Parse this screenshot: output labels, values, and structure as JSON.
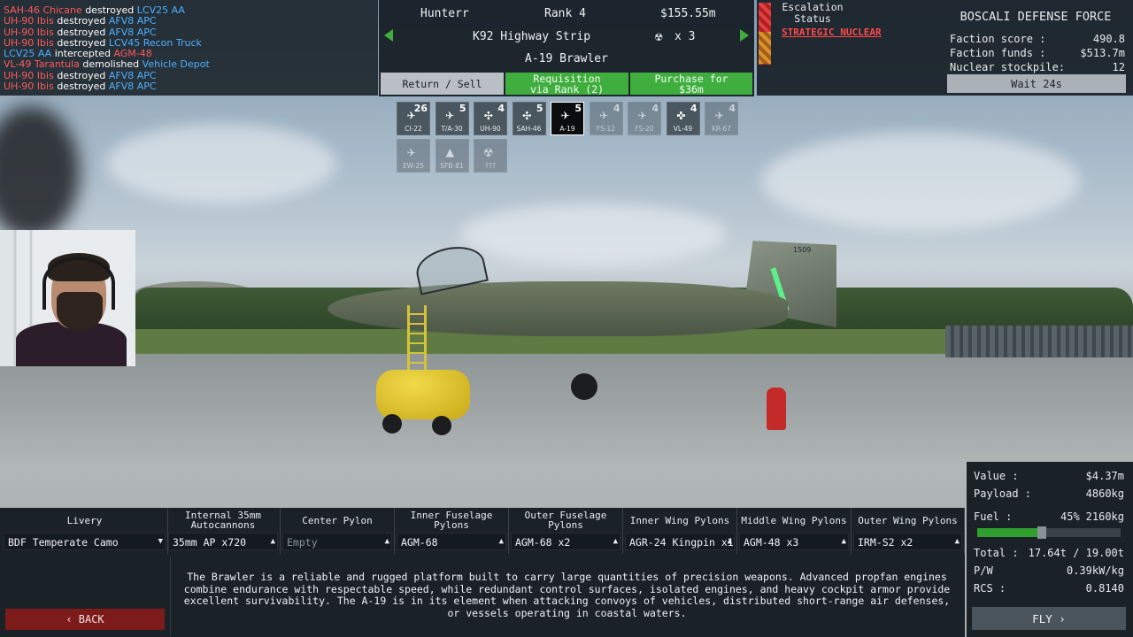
{
  "killfeed": [
    {
      "a": "SAH-46 Chicane",
      "ac": "kf-r",
      "verb": "destroyed",
      "t": "LCV25 AA",
      "tc": "kf-b"
    },
    {
      "a": "UH-90 Ibis",
      "ac": "kf-r",
      "verb": "destroyed",
      "t": "AFV8 APC",
      "tc": "kf-b"
    },
    {
      "a": "UH-90 Ibis",
      "ac": "kf-r",
      "verb": "destroyed",
      "t": "AFV8 APC",
      "tc": "kf-b"
    },
    {
      "a": "UH-90 Ibis",
      "ac": "kf-r",
      "verb": "destroyed",
      "t": "LCV45 Recon Truck",
      "tc": "kf-b"
    },
    {
      "a": "LCV25 AA",
      "ac": "kf-b",
      "verb": "intercepted",
      "t": "AGM-48",
      "tc": "kf-r"
    },
    {
      "a": "VL-49 Tarantula",
      "ac": "kf-r",
      "verb": "demolished",
      "t": "Vehicle Depot",
      "tc": "kf-b"
    },
    {
      "a": "UH-90 Ibis",
      "ac": "kf-r",
      "verb": "destroyed",
      "t": "AFV8 APC",
      "tc": "kf-b"
    },
    {
      "a": "UH-90 Ibis",
      "ac": "kf-r",
      "verb": "destroyed",
      "t": "AFV8 APC",
      "tc": "kf-b"
    }
  ],
  "player": {
    "name": "Hunterr",
    "rank": "Rank 4",
    "funds": "$155.55m"
  },
  "location": {
    "name": "K92 Highway Strip",
    "nuke_icon": "radiation-icon",
    "nuke_count": "x 3"
  },
  "aircraft_name": "A-19 Brawler",
  "buttons": {
    "return_sell": "Return / Sell",
    "requisition_l1": "Requisition",
    "requisition_l2": "via Rank (2)",
    "purchase_l1": "Purchase for",
    "purchase_l2": "$36m",
    "back": "‹ BACK",
    "fly": "FLY ›",
    "wait": "Wait 24s"
  },
  "escalation": {
    "title_l1": "Escalation",
    "title_l2": "Status",
    "level": "STRATEGIC NUCLEAR",
    "level_color": "#ff4a4a"
  },
  "faction": {
    "name": "BOSCALI DEFENSE FORCE",
    "score_label": "Faction score :",
    "score": "490.8",
    "funds_label": "Faction funds :",
    "funds": "$513.7m",
    "nuke_label": "Nuclear stockpile:",
    "nuke": "12"
  },
  "aircraft_slots": [
    {
      "label": "CI-22",
      "count": "26",
      "icon": "cargo-plane-icon",
      "state": "normal"
    },
    {
      "label": "T/A-30",
      "count": "5",
      "icon": "jet-icon",
      "state": "normal"
    },
    {
      "label": "UH-90",
      "count": "4",
      "icon": "helicopter-icon",
      "state": "normal"
    },
    {
      "label": "SAH-46",
      "count": "5",
      "icon": "helicopter-icon",
      "state": "normal"
    },
    {
      "label": "A-19",
      "count": "5",
      "icon": "attack-jet-icon",
      "state": "sel"
    },
    {
      "label": "FS-12",
      "count": "4",
      "icon": "fighter-icon",
      "state": "dim"
    },
    {
      "label": "FS-20",
      "count": "4",
      "icon": "fighter-icon",
      "state": "dim"
    },
    {
      "label": "VL-49",
      "count": "4",
      "icon": "tiltrotor-icon",
      "state": "normal"
    },
    {
      "label": "KR-67",
      "count": "4",
      "icon": "fighter-icon",
      "state": "dim"
    },
    {
      "label": "EW-25",
      "count": "",
      "icon": "awacs-icon",
      "state": "dim"
    },
    {
      "label": "SFB-81",
      "count": "",
      "icon": "bomber-icon",
      "state": "dim"
    },
    {
      "label": "???",
      "count": "",
      "icon": "nuke-icon",
      "state": "dim"
    }
  ],
  "loadout": [
    {
      "header": "Livery",
      "value": "BDF Temperate Camo",
      "tri": "▼"
    },
    {
      "header": "Internal 35mm Autocannons",
      "value": "35mm AP x720",
      "tri": "▲"
    },
    {
      "header": "Center Pylon",
      "value": "Empty",
      "tri": "▲"
    },
    {
      "header": "Inner Fuselage Pylons",
      "value": "AGM-68",
      "tri": "▲"
    },
    {
      "header": "Outer Fuselage Pylons",
      "value": "AGM-68 x2",
      "tri": "▲"
    },
    {
      "header": "Inner Wing Pylons",
      "value": "AGR-24 Kingpin x12",
      "tri": "▲"
    },
    {
      "header": "Middle Wing Pylons",
      "value": "AGM-48 x3",
      "tri": "▲"
    },
    {
      "header": "Outer Wing Pylons",
      "value": "IRM-S2 x2",
      "tri": "▲"
    }
  ],
  "description": "The Brawler is a reliable and rugged platform built to carry large quantities of precision weapons. Advanced propfan engines combine endurance with respectable speed, while redundant control surfaces, isolated engines, and heavy cockpit armor provide excellent survivability. The A-19 is in its element when attacking convoys of vehicles, distributed short-range air defenses, or vessels operating in coastal waters.",
  "stats": {
    "value_label": "Value :",
    "value": "$4.37m",
    "payload_label": "Payload :",
    "payload": "4860kg",
    "fuel_label": "Fuel :",
    "fuel_pct": "45%",
    "fuel_kg": "2160kg",
    "fuel_fraction": 0.45,
    "total_label": "Total :",
    "total": "17.64t / 19.00t",
    "pw_label": "P/W",
    "pw": "0.39kW/kg",
    "rcs_label": "RCS :",
    "rcs": "0.8140"
  },
  "aircraft_tail_number": "1509"
}
